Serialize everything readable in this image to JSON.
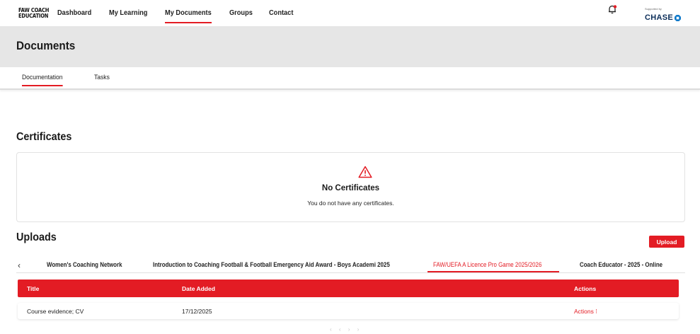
{
  "brand": {
    "logo_line1": "FAW COACH",
    "logo_line2": "EDUCATION"
  },
  "nav": [
    {
      "label": "Dashboard"
    },
    {
      "label": "My Learning"
    },
    {
      "label": "My Documents"
    },
    {
      "label": "Groups"
    },
    {
      "label": "Contact"
    }
  ],
  "sponsor": {
    "supported_by": "Supported by",
    "name": "CHASE"
  },
  "page": {
    "title": "Documents"
  },
  "subtabs": [
    {
      "label": "Documentation"
    },
    {
      "label": "Tasks"
    }
  ],
  "certificates": {
    "title": "Certificates",
    "empty_title": "No Certificates",
    "empty_text": "You do not have any certificates."
  },
  "uploads": {
    "title": "Uploads",
    "upload_label": "Upload",
    "tabs": [
      {
        "label": "Women's Coaching Network"
      },
      {
        "label": "Introduction to Coaching Football & Football Emergency Aid Award - Boys Academi 2025"
      },
      {
        "label": "FAW/UEFA A Licence Pro Game 2025/2026"
      },
      {
        "label": "Coach Educator - 2025 - Online"
      }
    ],
    "columns": {
      "title": "Title",
      "date": "Date Added",
      "actions": "Actions"
    },
    "rows": [
      {
        "title": "Course evidence; CV",
        "date": "17/12/2025",
        "actions": "Actions ⁝"
      }
    ],
    "pager": "‹ ‹ › ›"
  },
  "colors": {
    "accent": "#e31c24",
    "band": "#e6e6e6",
    "sponsor": "#0d2f5a"
  }
}
